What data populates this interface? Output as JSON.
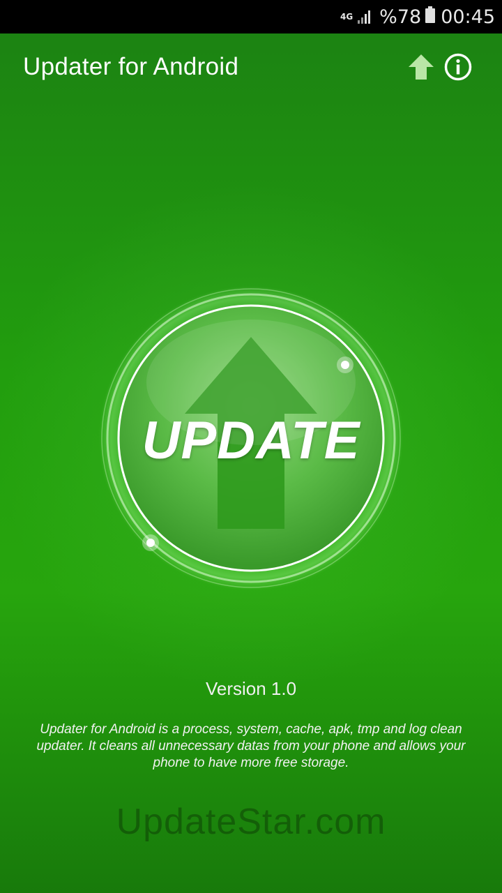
{
  "status_bar": {
    "network": "4G",
    "battery_percent": "%78",
    "time": "00:45",
    "icons": [
      "signal-icon",
      "battery-icon"
    ]
  },
  "app_bar": {
    "title": "Updater for Android",
    "actions": [
      "upload-arrow-icon",
      "info-icon"
    ]
  },
  "main": {
    "button_label": "UPDATE",
    "button_icon": "arrow-up-icon",
    "version": "Version 1.0",
    "description": "Updater for Android is a process, system, cache, apk, tmp and log clean updater. It cleans all unnecessary datas from your phone and allows your phone to have more free storage.",
    "watermark": "UpdateStar.com"
  },
  "colors": {
    "background": "#229e0e",
    "accent": "#ffffff",
    "status_bar": "#000000"
  }
}
